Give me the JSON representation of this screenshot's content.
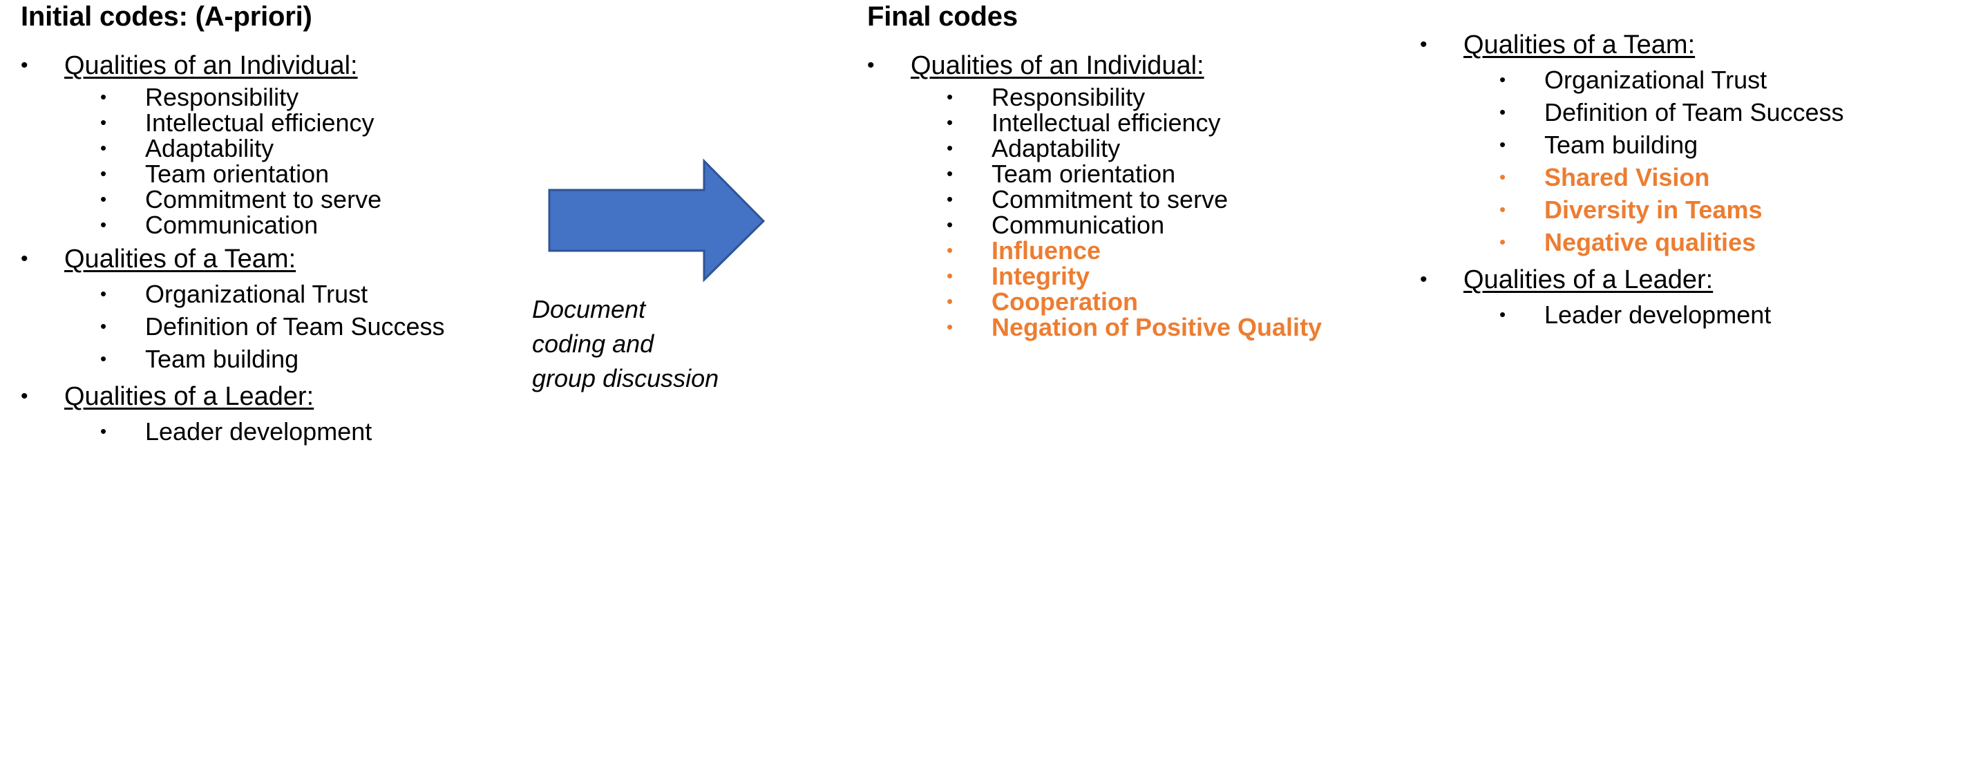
{
  "colors": {
    "text": "#000000",
    "added_code": "#ED7D31",
    "arrow_fill": "#4472C4",
    "arrow_stroke": "#2E5496",
    "background": "#FFFFFF"
  },
  "bullet_glyph": "•",
  "initial_codes": {
    "title": "Initial codes: (A-priori)",
    "groups": [
      {
        "heading": "Qualities of an Individual:",
        "items": [
          {
            "label": "Responsibility",
            "added": false
          },
          {
            "label": "Intellectual efficiency",
            "added": false
          },
          {
            "label": "Adaptability",
            "added": false
          },
          {
            "label": "Team orientation",
            "added": false
          },
          {
            "label": "Commitment to serve",
            "added": false
          },
          {
            "label": "Communication",
            "added": false
          }
        ]
      },
      {
        "heading": "Qualities of a Team:",
        "items": [
          {
            "label": "Organizational Trust",
            "added": false
          },
          {
            "label": "Definition of Team Success",
            "added": false
          },
          {
            "label": "Team building",
            "added": false
          }
        ]
      },
      {
        "heading": "Qualities of a Leader:",
        "items": [
          {
            "label": "Leader development",
            "added": false
          }
        ]
      }
    ]
  },
  "transition": {
    "arrow_direction": "right",
    "caption": "Document\ncoding and\ngroup discussion"
  },
  "final_codes": {
    "title": "Final codes",
    "groups": [
      {
        "heading": "Qualities of an Individual:",
        "items": [
          {
            "label": "Responsibility",
            "added": false
          },
          {
            "label": "Intellectual efficiency",
            "added": false
          },
          {
            "label": "Adaptability",
            "added": false
          },
          {
            "label": "Team orientation",
            "added": false
          },
          {
            "label": "Commitment to serve",
            "added": false
          },
          {
            "label": "Communication",
            "added": false
          },
          {
            "label": "Influence",
            "added": true
          },
          {
            "label": "Integrity",
            "added": true
          },
          {
            "label": "Cooperation",
            "added": true
          },
          {
            "label": "Negation of Positive Quality",
            "added": true
          }
        ]
      }
    ]
  },
  "final_codes_right": {
    "groups": [
      {
        "heading": "Qualities of a Team:",
        "items": [
          {
            "label": "Organizational Trust",
            "added": false
          },
          {
            "label": "Definition of Team Success",
            "added": false
          },
          {
            "label": "Team building",
            "added": false
          },
          {
            "label": "Shared Vision",
            "added": true
          },
          {
            "label": "Diversity in Teams",
            "added": true
          },
          {
            "label": "Negative qualities",
            "added": true
          }
        ]
      },
      {
        "heading": "Qualities of a Leader:",
        "items": [
          {
            "label": "Leader development",
            "added": false
          }
        ]
      }
    ]
  }
}
